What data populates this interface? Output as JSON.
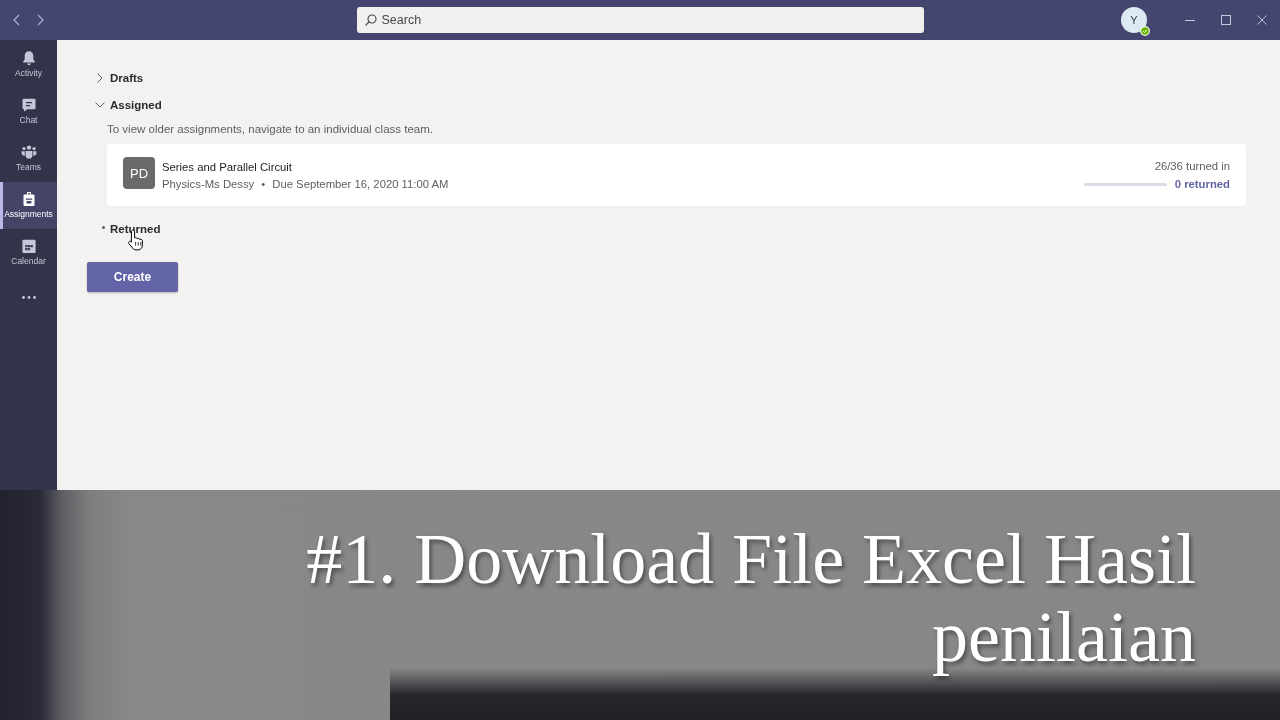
{
  "title_bar": {
    "search": {
      "placeholder": "Search"
    },
    "avatar": {
      "initials": "Y"
    }
  },
  "rail": {
    "items": [
      {
        "label": "Activity",
        "selected": false
      },
      {
        "label": "Chat",
        "selected": false
      },
      {
        "label": "Teams",
        "selected": false
      },
      {
        "label": "Assignments",
        "selected": true
      },
      {
        "label": "Calendar",
        "selected": false
      }
    ]
  },
  "sections": [
    {
      "label": "Drafts",
      "kind": "chevron",
      "expanded": false
    },
    {
      "label": "Assigned",
      "kind": "chevron",
      "expanded": true,
      "note": "To view older assignments, navigate to an individual class team.",
      "assignments": [
        {
          "initials": "PD",
          "title": "Series and Parallel Circuit",
          "class": "Physics-Ms Dessy",
          "separator": "•",
          "due": "Due September 16, 2020 11:00 AM",
          "turned_in": "26/36 turned in",
          "level": 0,
          "returned": "0 returned"
        }
      ]
    },
    {
      "label": "Returned",
      "kind": "dot"
    }
  ],
  "create_button": {
    "label": "Create"
  },
  "caption": {
    "text": "#1. Download File Excel Hasil penilaian"
  }
}
